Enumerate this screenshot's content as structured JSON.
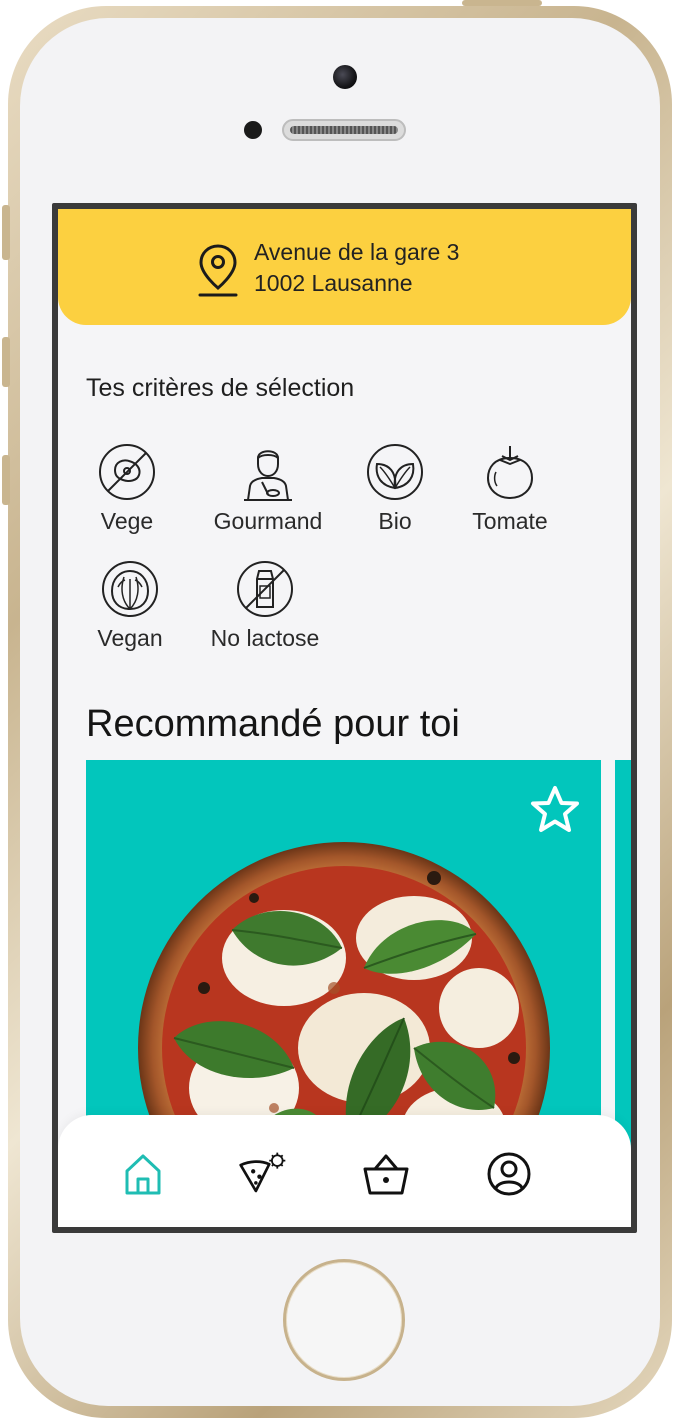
{
  "header": {
    "address_line1": "Avenue de la gare 3",
    "address_line2": "1002 Lausanne",
    "icon": "location-pin-icon",
    "background": "#fcd040"
  },
  "criteria": {
    "title": "Tes critères de sélection",
    "items": [
      {
        "label": "Vege",
        "icon": "no-meat-icon"
      },
      {
        "label": "Gourmand",
        "icon": "person-eating-icon"
      },
      {
        "label": "Bio",
        "icon": "leaves-icon"
      },
      {
        "label": "Tomate",
        "icon": "tomato-icon"
      },
      {
        "label": "Vegan",
        "icon": "cabbage-icon"
      },
      {
        "label": "No lactose",
        "icon": "no-milk-icon"
      }
    ]
  },
  "recommended": {
    "title": "Recommandé pour toi",
    "card_color": "#02c6bc",
    "favorite_icon": "star-outline-icon",
    "image": "margherita-pizza"
  },
  "nav": {
    "items": [
      {
        "icon": "home-icon",
        "active": true
      },
      {
        "icon": "pizza-custom-icon",
        "active": false
      },
      {
        "icon": "basket-icon",
        "active": false
      },
      {
        "icon": "profile-icon",
        "active": false
      }
    ],
    "active_color": "#1fbdb3"
  }
}
